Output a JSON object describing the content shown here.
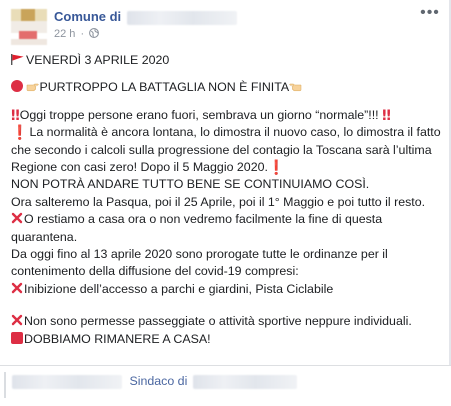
{
  "header": {
    "page_name": "Comune di",
    "time_ago": "22 h",
    "separator": "·",
    "more_label": "•••"
  },
  "post": {
    "lines": {
      "date": "VENERDÌ 3 APRILE 2020",
      "headline": "PURTROPPO LA BATTAGLIA NON È FINITA",
      "crowd_1": "Oggi troppe persone erano fuori, sembrava un giorno “normale”!!! ",
      "normality": "La normalità è ancora lontana, lo dimostra il nuovo caso, lo dimostra il fatto che secondo i calcoli sulla progressione del contagio la Toscana sarà l’ultima Regione con casi zero! Dopo il 5 Maggio 2020.",
      "not_ok": "NON POTRÀ ANDARE TUTTO BENE SE CONTINUIAMO COSÌ.",
      "holidays": "Ora salteremo la Pasqua, poi il 25 Aprile, poi il 1° Maggio e poi tutto il resto.",
      "stay_home": "O restiamo a casa ora o non vedremo facilmente la fine di questa quarantena.",
      "ordinances": "Da oggi fino al 13 aprile 2020 sono prorogate tutte le ordinanze per il contenimento della diffusione del covid-19 compresi:",
      "parks": "Inibizione dell’accesso a parchi e giardini, Pista Ciclabile",
      "walks": "Non sono permesse passeggiate o attività sportive neppure individuali.",
      "must_stay": "DOBBIAMO RIMANERE A CASA!"
    },
    "icons": {
      "flag": "red-flag-icon",
      "circle": "red-circle-icon",
      "pointing": "pointing-right-hand-icon",
      "double_excl": "double-exclamation-icon",
      "excl": "exclamation-icon",
      "cross": "cross-mark-icon",
      "square": "red-square-icon"
    },
    "symbols": {
      "double_excl": "‼",
      "excl": "❗"
    }
  },
  "footer": {
    "sindaco_label": "Sindaco di"
  },
  "colors": {
    "link": "#385898",
    "accent_red": "#dd2e44",
    "meta": "#8d949e"
  }
}
